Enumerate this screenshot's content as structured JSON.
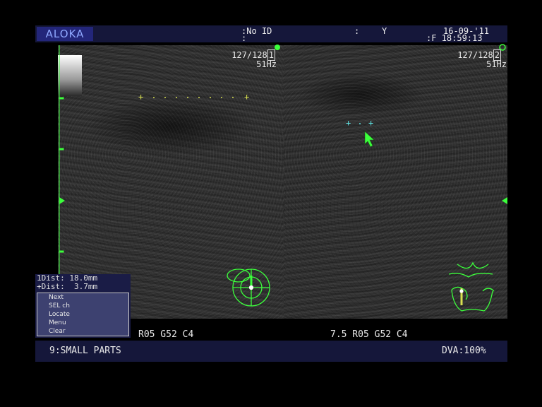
{
  "header": {
    "brand": "ALOKA",
    "patient_id": ":No ID",
    "mid_field": ":",
    "mid_field2": "Y",
    "date": "16-09-'11",
    "time": ":F 18:59:13",
    "colon": ":"
  },
  "left_image": {
    "frame": "127/128",
    "frame_marker": "1",
    "frame_rate": "51Hz",
    "caliper_label": "1",
    "params": "R05 G52 C4"
  },
  "right_image": {
    "frame": "127/128",
    "frame_marker": "2",
    "frame_rate": "51Hz",
    "params": "7.5 R05 G52 C4"
  },
  "measurements": {
    "dist1": "1Dist: 18.0mm",
    "dist2": "+Dist:  3.7mm"
  },
  "menu": {
    "items": [
      "Next",
      "SEL ch",
      "Locate",
      "Menu",
      "Clear"
    ]
  },
  "footer": {
    "preset": "9:SMALL PARTS",
    "dva": "DVA:100%"
  },
  "colors": {
    "overlay_green": "#3cff3c",
    "caliper_yellow": "#d8e050",
    "caliper_cyan": "#60e0e0",
    "bar_bg": "#15173a"
  }
}
